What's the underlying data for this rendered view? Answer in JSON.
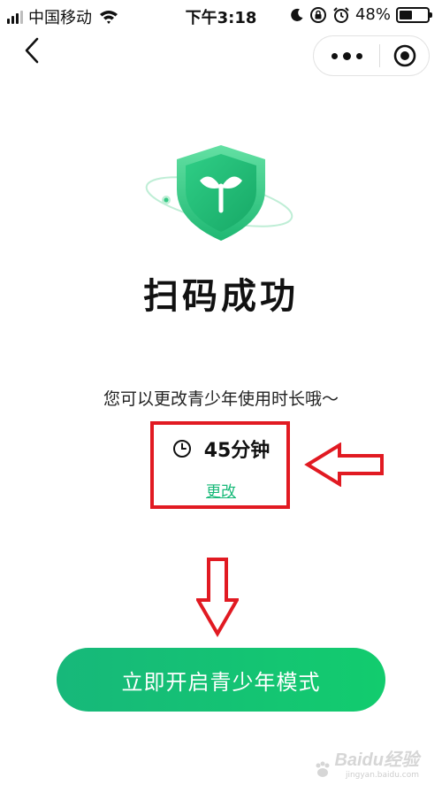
{
  "status_bar": {
    "carrier": "中国移动",
    "time": "下午3:18",
    "battery_percent": "48%",
    "battery_level": 0.48,
    "icons": [
      "signal-icon",
      "wifi-icon",
      "moon-icon",
      "rotation-lock-icon",
      "alarm-icon",
      "battery-icon"
    ]
  },
  "nav": {
    "back_icon": "chevron-left-icon",
    "more_icon": "more-dots-icon",
    "close_icon": "target-circle-icon"
  },
  "main": {
    "illustration_icon": "shield-sprout-icon",
    "title": "扫码成功",
    "subtitle": "您可以更改青少年使用时长哦～",
    "duration_icon": "clock-icon",
    "duration": "45分钟",
    "change_link": "更改"
  },
  "primary_button": {
    "label": "立即开启青少年模式"
  },
  "annotations": {
    "box_color": "#e11a22",
    "arrow_color": "#e11a22"
  },
  "watermark": {
    "brand": "Baidu经验",
    "url": "jingyan.baidu.com"
  },
  "colors": {
    "accent_green": "#17b978",
    "button_gradient_start": "#17b87a",
    "button_gradient_end": "#12cc6e"
  }
}
